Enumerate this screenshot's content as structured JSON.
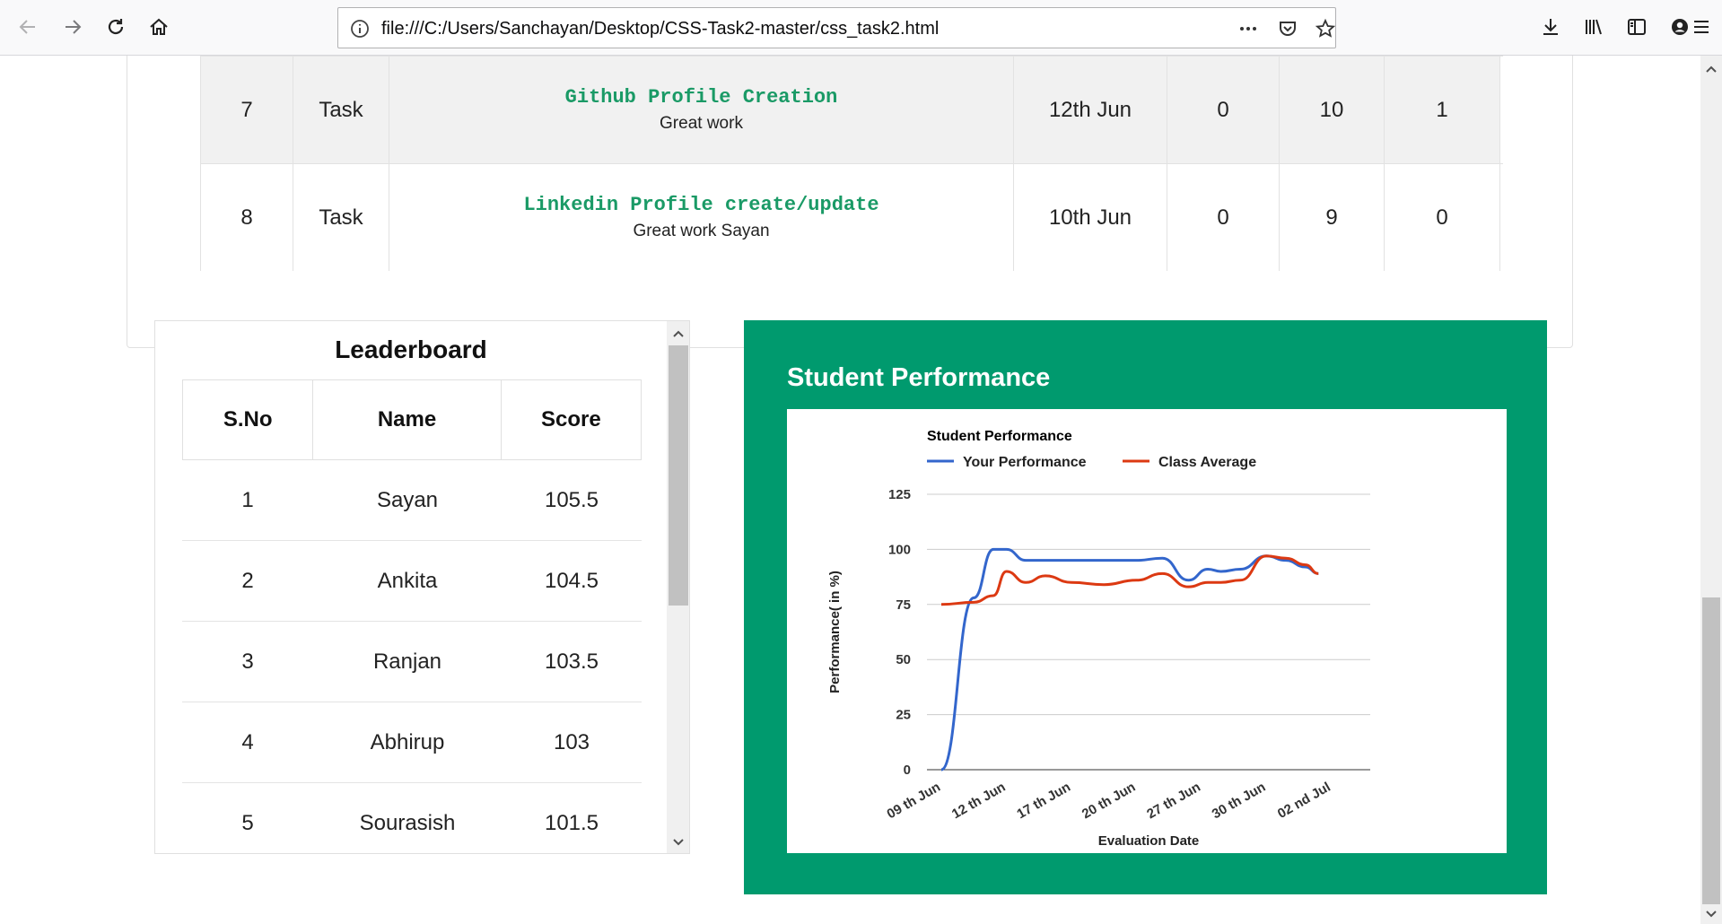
{
  "browser": {
    "url": "file:///C:/Users/Sanchayan/Desktop/CSS-Task2-master/css_task2.html",
    "icons": [
      "back-icon",
      "forward-icon",
      "reload-icon",
      "home-icon",
      "info-icon",
      "more-icon",
      "pocket-icon",
      "bookmark-star-icon",
      "download-icon",
      "library-icon",
      "sidebar-icon",
      "account-icon",
      "menu-icon"
    ]
  },
  "tasks": {
    "rows": [
      {
        "no": "7",
        "type": "Task",
        "title": "Github Profile Creation",
        "comment": "Great work",
        "date": "12th Jun",
        "a": "0",
        "b": "10",
        "c": "1"
      },
      {
        "no": "8",
        "type": "Task",
        "title": "Linkedin Profile create/update",
        "comment": "Great work Sayan",
        "date": "10th Jun",
        "a": "0",
        "b": "9",
        "c": "0"
      }
    ]
  },
  "leaderboard": {
    "title": "Leaderboard",
    "headers": {
      "sno": "S.No",
      "name": "Name",
      "score": "Score"
    },
    "rows": [
      {
        "sno": "1",
        "name": "Sayan",
        "score": "105.5"
      },
      {
        "sno": "2",
        "name": "Ankita",
        "score": "104.5"
      },
      {
        "sno": "3",
        "name": "Ranjan",
        "score": "103.5"
      },
      {
        "sno": "4",
        "name": "Abhirup",
        "score": "103"
      },
      {
        "sno": "5",
        "name": "Sourasish",
        "score": "101.5"
      }
    ]
  },
  "performance": {
    "panel_title": "Student Performance",
    "accent_color": "#009a6e"
  },
  "chart_data": {
    "type": "line",
    "title": "Student Performance",
    "xlabel": "Evaluation Date",
    "ylabel": "Performance( in %)",
    "ylim": [
      0,
      125
    ],
    "yticks": [
      0,
      25,
      50,
      75,
      100,
      125
    ],
    "categories": [
      "09 th Jun",
      "12 th Jun",
      "17 th Jun",
      "20 th Jun",
      "27 th Jun",
      "30 th Jun",
      "02 nd Jul"
    ],
    "grid": true,
    "legend": "top",
    "x": [
      0,
      0.5,
      0.8,
      1.0,
      1.3,
      1.6,
      2.0,
      2.5,
      3.0,
      3.4,
      3.8,
      4.1,
      4.3,
      4.6,
      5.0,
      5.3,
      5.6,
      5.8
    ],
    "series": [
      {
        "name": "Your Performance",
        "color": "#3366cc",
        "values": [
          0,
          78,
          100,
          100,
          95,
          95,
          95,
          95,
          95,
          96,
          86,
          91,
          90,
          91,
          97,
          95,
          92,
          89
        ]
      },
      {
        "name": "Class Average",
        "color": "#dc3912",
        "values": [
          75,
          76,
          79,
          90,
          85,
          88,
          85,
          84,
          86,
          89,
          83,
          85,
          85,
          86,
          97,
          96,
          93,
          89
        ]
      }
    ]
  }
}
